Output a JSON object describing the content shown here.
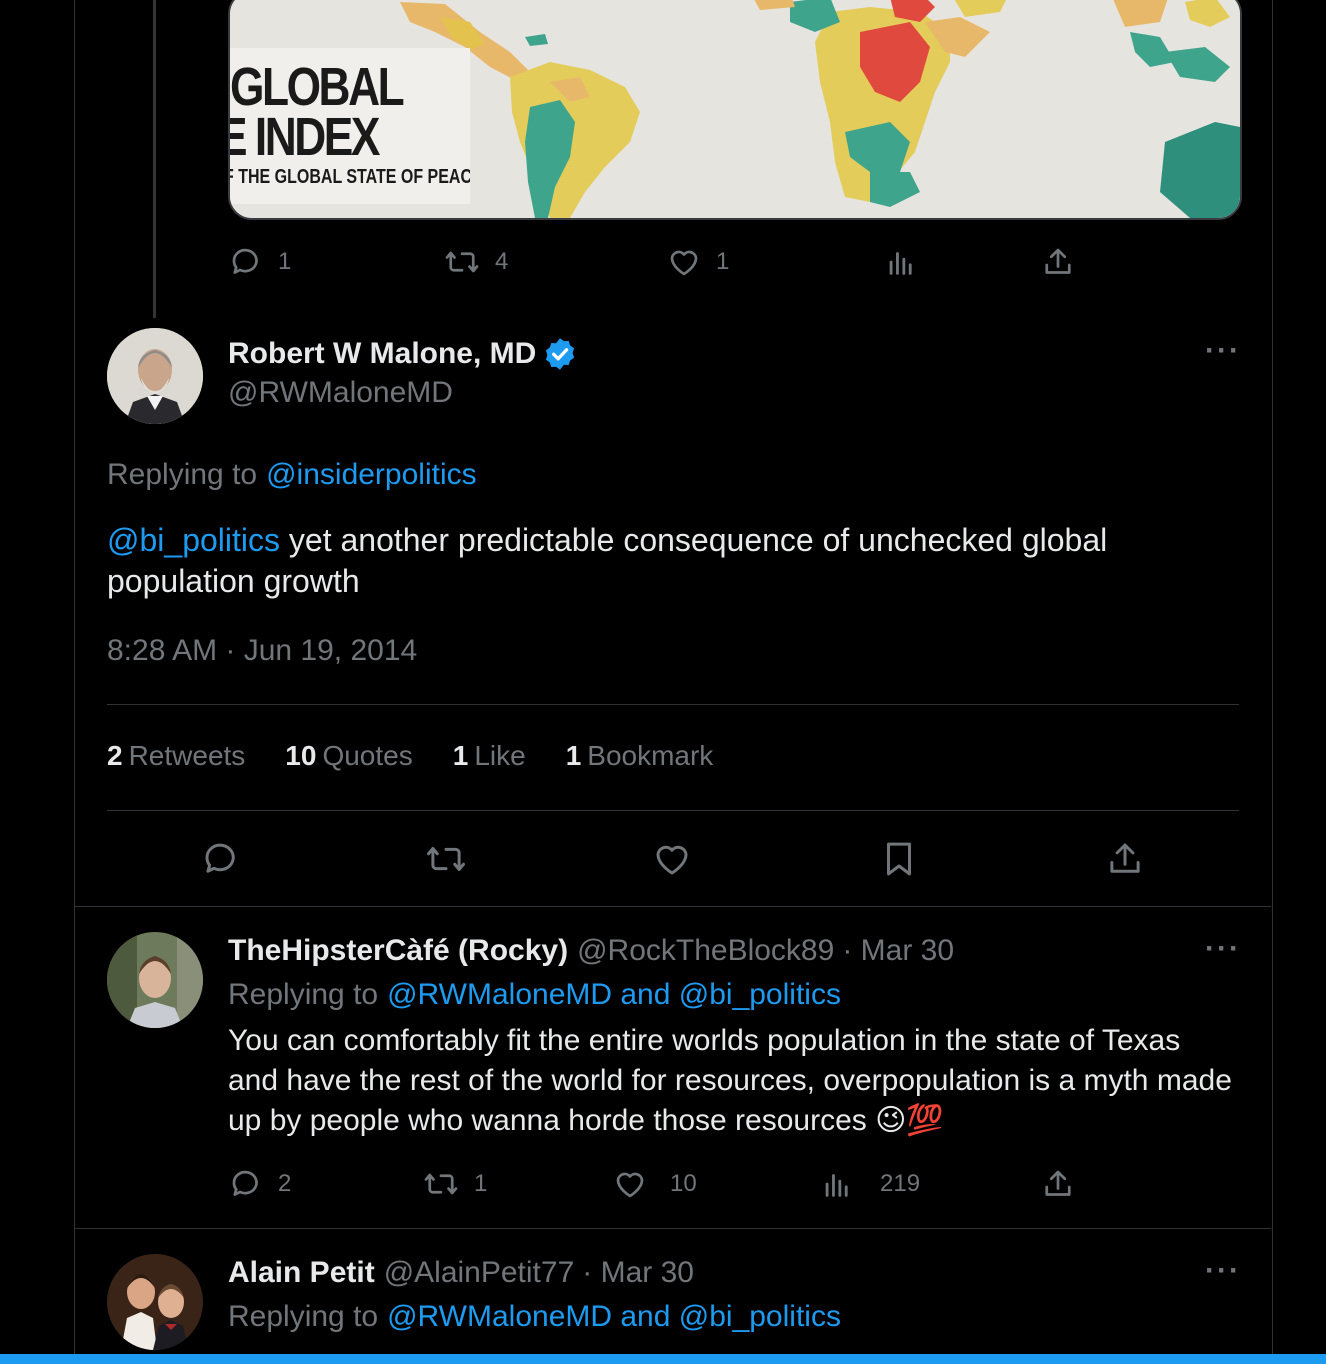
{
  "colors": {
    "accent": "#1d9bf0",
    "muted": "#71767b",
    "text": "#e7e9ea",
    "background": "#000000"
  },
  "quoted_media": {
    "line1": "GLOBAL",
    "line2": "E INDEX",
    "line3": "F THE GLOBAL STATE OF PEACE"
  },
  "previous_tweet_actions": {
    "replies": "1",
    "retweets": "4",
    "likes": "1"
  },
  "main_tweet": {
    "author_name": "Robert W Malone, MD",
    "author_handle": "@RWMaloneMD",
    "verified_icon": "verified-badge-icon",
    "replying_prefix": "Replying to",
    "replying_to": "@insiderpolitics",
    "mention": "@bi_politics",
    "text": " yet another predictable consequence of unchecked global population growth",
    "timestamp": "8:28 AM · Jun 19, 2014",
    "stats": [
      {
        "count": "2",
        "label": "Retweets"
      },
      {
        "count": "10",
        "label": "Quotes"
      },
      {
        "count": "1",
        "label": "Like"
      },
      {
        "count": "1",
        "label": "Bookmark"
      }
    ],
    "actions": [
      "reply-icon",
      "retweet-icon",
      "like-icon",
      "bookmark-icon",
      "share-icon"
    ]
  },
  "replies": [
    {
      "name": "TheHipsterCàfé (Rocky)",
      "handle": "@RockTheBlock89",
      "date": "· Mar 30",
      "replying_prefix": "Replying to",
      "replying_to": "@RWMaloneMD and @bi_politics",
      "text": "You can comfortably fit the entire worlds population in the state of Texas and have the rest of the world for resources, overpopulation is a myth made up by people who wanna horde those resources 😉💯",
      "replies": "2",
      "retweets": "1",
      "likes": "10",
      "views": "219"
    },
    {
      "name": "Alain Petit",
      "handle": "@AlainPetit77",
      "date": "· Mar 30",
      "replying_prefix": "Replying to",
      "replying_to": "@RWMaloneMD and @bi_politics"
    }
  ],
  "more_label": "···"
}
